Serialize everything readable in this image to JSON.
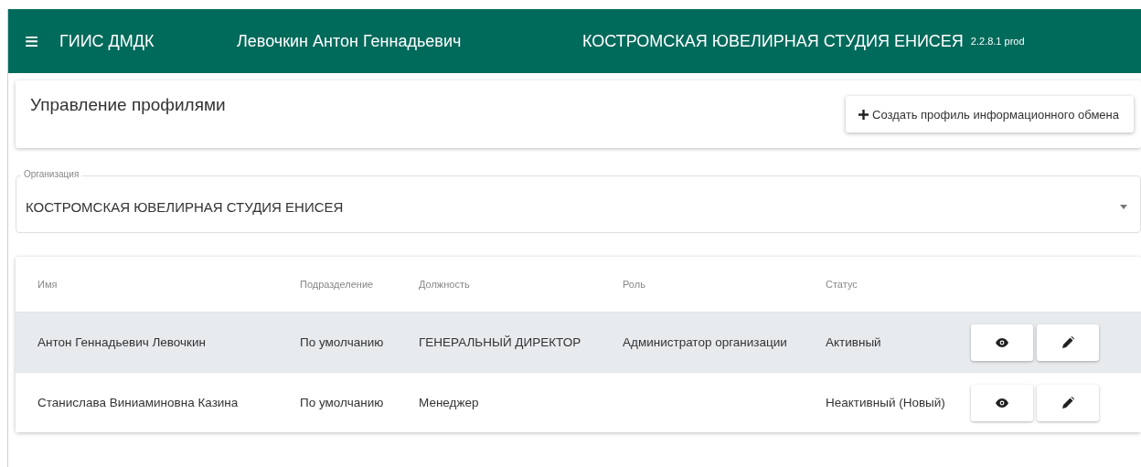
{
  "header": {
    "menu_icon": "≡",
    "app_name": "ГИИС ДМДК",
    "user": "Левочкин Антон Геннадьевич",
    "organization": "КОСТРОМСКАЯ ЮВЕЛИРНАЯ СТУДИЯ ЕНИСЕЯ",
    "version": "2.2.8.1 prod"
  },
  "page": {
    "title": "Управление профилями",
    "create_button": "Создать профиль информационного обмена"
  },
  "organization_field": {
    "label": "Организация",
    "value": "КОСТРОМСКАЯ ЮВЕЛИРНАЯ СТУДИЯ ЕНИСЕЯ"
  },
  "table": {
    "columns": [
      "Имя",
      "Подразделение",
      "Должность",
      "Роль",
      "Статус"
    ],
    "rows": [
      {
        "cells": [
          "Антон Геннадьевич Левочкин",
          "По умолчанию",
          "ГЕНЕРАЛЬНЫЙ ДИРЕКТОР",
          "Администратор организации",
          "Активный"
        ],
        "selected": true
      },
      {
        "cells": [
          "Станислава Виниаминовна Казина",
          "По умолчанию",
          "Менеджер",
          "",
          "Неактивный (Новый)"
        ],
        "selected": false
      }
    ]
  }
}
